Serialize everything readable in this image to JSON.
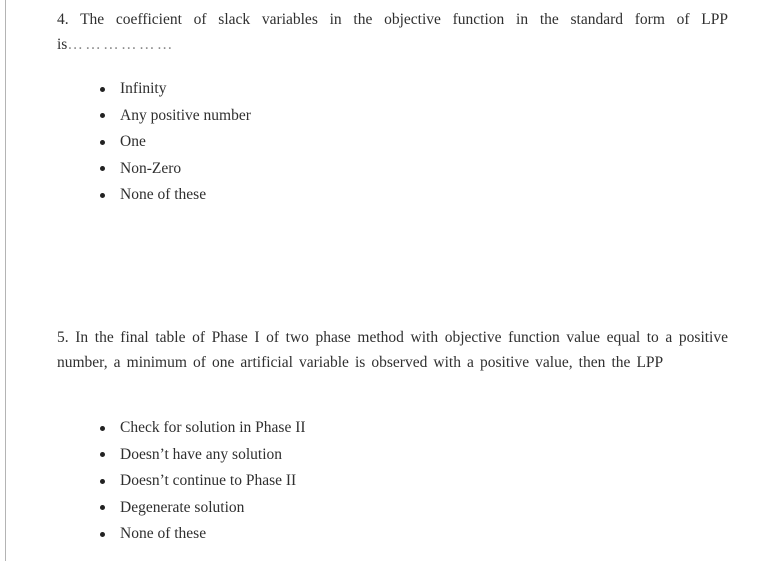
{
  "page": {
    "background_color": "#ffffff",
    "text_color": "#2f2f2f",
    "edge_artifact_color": "#b4b4b4"
  },
  "questions": [
    {
      "number": "4.",
      "stem": "4. The coefficient of slack variables in the objective function in the standard form of LPP is",
      "blank": "………………",
      "options": [
        {
          "label": "Infinity"
        },
        {
          "label": "Any positive number"
        },
        {
          "label": "One"
        },
        {
          "label": "Non-Zero"
        },
        {
          "label": "None of these"
        }
      ]
    },
    {
      "number": "5.",
      "stem": "5. In the final table of Phase I of two phase method with objective function value equal to a positive number, a minimum of one artificial variable is observed with a positive value, then the LPP",
      "blank": "",
      "options": [
        {
          "label": "Check for solution in Phase II"
        },
        {
          "label": "Doesn’t have any solution"
        },
        {
          "label": "Doesn’t continue to Phase II"
        },
        {
          "label": "Degenerate solution"
        },
        {
          "label": "None of these"
        }
      ]
    }
  ]
}
